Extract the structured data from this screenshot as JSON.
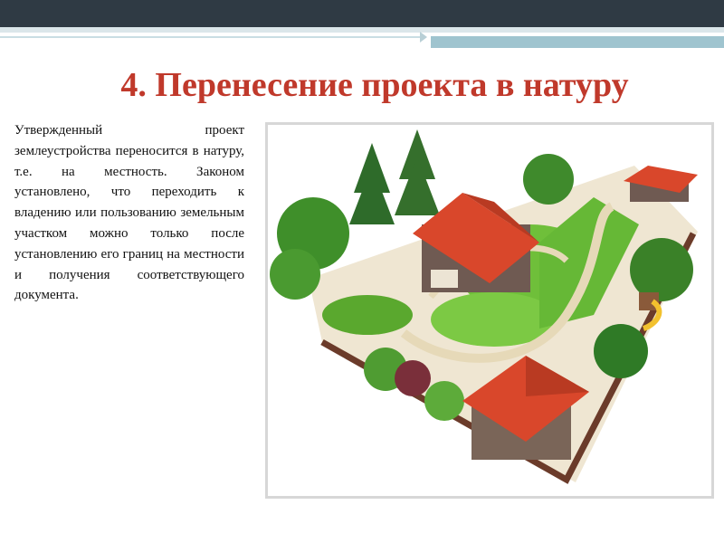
{
  "slide": {
    "title": "4. Перенесение проекта в натуру",
    "body": "Утвержденный проект землеустройства переносится в натуру, т.е. на местность. Законом установлено, что переходить к владению или пользованию земельным участком можно только после установлению его границ на местности и получения соответствующего документа."
  },
  "colors": {
    "title": "#c0392b",
    "header_bar": "#2f3a44",
    "accent": "#9fc4cf",
    "roof": "#d9472b",
    "lawn": "#6fbf3a"
  }
}
